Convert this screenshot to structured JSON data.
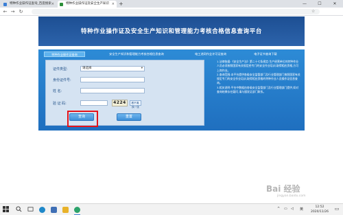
{
  "browser": {
    "tabs": [
      {
        "title": "特种作业操作证查询_百度搜索",
        "close": "×"
      },
      {
        "title": "特种作业操作证及安全生产知识",
        "close": "×"
      }
    ],
    "new_tab": "+",
    "window_controls": {
      "minimize": "—",
      "maximize": "☐",
      "close": "✕"
    },
    "nav": {
      "back": "←",
      "forward": "→",
      "reload": "↻",
      "star": "☆"
    }
  },
  "page": {
    "title": "特种作业操作证及安全生产知识和管理能力考核合格信息查询平台",
    "tabs": [
      {
        "label": "特种作业操作证查询",
        "active": true
      },
      {
        "label": "安全生产知识和管理能力考核合格信息查询",
        "active": false
      },
      {
        "label": "电工进网作业许可证查询",
        "active": false
      },
      {
        "label": "电子证书查询下载",
        "active": false
      }
    ],
    "form": {
      "cert_type_label": "证件类型:",
      "cert_type_value": "请选择",
      "id_label": "身份证件号:",
      "name_label": "姓  名:",
      "captcha_label": "验 证 码:",
      "captcha_text": "4224",
      "refresh_label": "看不清,换一张",
      "query_button": "查询",
      "reset_button": "重置"
    },
    "notes": [
      "1.法律依据:《安全生产法》第二十七条规定:生产经营单位的特种作业人员必须按照国家有关规定经专门的安全作业培训,取得相应资格,方可上岗作业。",
      "2.查询范围:本平台提供各级安全监管部门及行业管理部门按照国家有关规定专门的安全作业培训,取得相应资格的特种作业人员操作证信息查询。",
      "3.相关说明:平台中数据由各级安全监管部门及行业管理部门提供,如对查询结果存在疑问,请与颁发证部门联系。"
    ],
    "highlight_color": "#e3131a"
  },
  "taskbar": {
    "start_icon": "windows-logo",
    "search_icon": "search-icon",
    "tray_up": "^",
    "tray_lang": "英",
    "time": "12:52",
    "date": "2020/11/26",
    "notification": "▭"
  },
  "watermark": {
    "brand": "Bai 经验",
    "url": "jingyan.baidu.com"
  }
}
